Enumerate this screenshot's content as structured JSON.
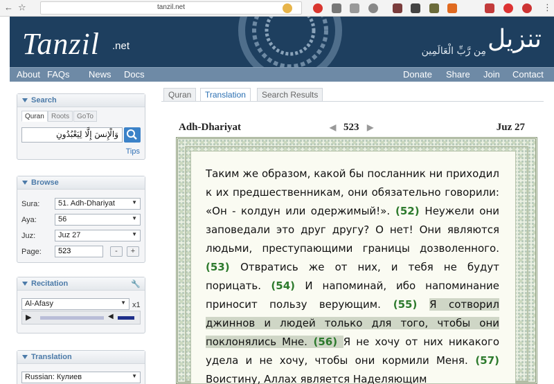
{
  "browser": {
    "url": "tanzil.net"
  },
  "header": {
    "logo": "Tanzil",
    "logo_suffix": ".net",
    "arabic_logo": "تنزيل",
    "arabic_tagline": "مِن رَّبِّ الْعَالَمِين"
  },
  "menu": {
    "left": [
      "About",
      "FAQs",
      "News",
      "Docs"
    ],
    "right": [
      "Donate",
      "Share",
      "Join",
      "Contact"
    ]
  },
  "search": {
    "title": "Search",
    "tabs": [
      "Quran",
      "Roots",
      "GoTo"
    ],
    "query": "وَالْإِنسَ إِلَّا لِيَعْبُدُونِ",
    "tips": "Tips"
  },
  "browse": {
    "title": "Browse",
    "sura_label": "Sura:",
    "sura_value": "51. Adh-Dhariyat",
    "aya_label": "Aya:",
    "aya_value": "56",
    "juz_label": "Juz:",
    "juz_value": "Juz 27",
    "page_label": "Page:",
    "page_value": "523",
    "minus": "-",
    "plus": "+"
  },
  "recitation": {
    "title": "Recitation",
    "reciter": "Al-Afasy",
    "repeat": "x1"
  },
  "translation_panel": {
    "title": "Translation",
    "value": "Russian: Кулиев"
  },
  "main": {
    "tabs": [
      "Quran",
      "Translation",
      "Search Results"
    ],
    "surah_name": "Adh-Dhariyat",
    "page_number": "523",
    "juz": "Juz 27",
    "segments": [
      {
        "text": "Таким же образом, какой бы посланник ни приходил к их предшественникам, они обязательно говорили: «Он - колдун или одержимый!».",
        "type": "text"
      },
      {
        "text": " (52) ",
        "type": "num"
      },
      {
        "text": "Неужели они заповедали это друг другу? О нет! Они являются людьми, преступающими границы дозволенного.",
        "type": "text"
      },
      {
        "text": " (53) ",
        "type": "num"
      },
      {
        "text": "Отвратись же от них, и тебя не будут порицать.",
        "type": "text"
      },
      {
        "text": " (54) ",
        "type": "num"
      },
      {
        "text": "И напоминай, ибо напоминание приносит пользу верующим.",
        "type": "text"
      },
      {
        "text": " (55) ",
        "type": "num"
      },
      {
        "text": "Я сотворил джиннов и людей только для того, чтобы они поклонялись Мне.",
        "type": "hl"
      },
      {
        "text": " (56) ",
        "type": "hlnum"
      },
      {
        "text": "Я не хочу от них никакого удела и не хочу, чтобы они кормили Меня.",
        "type": "text"
      },
      {
        "text": " (57) ",
        "type": "num"
      },
      {
        "text": "Воистину, Аллах является Наделяющим",
        "type": "text"
      }
    ]
  }
}
